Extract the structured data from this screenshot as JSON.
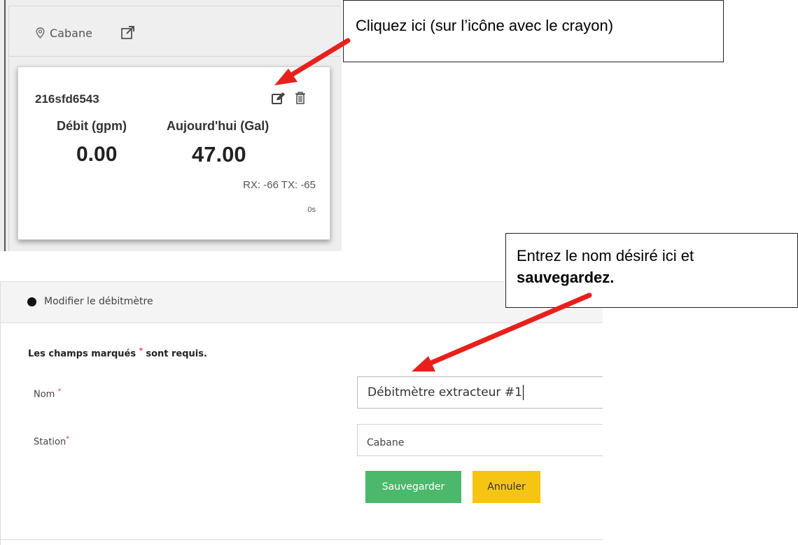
{
  "station_card": {
    "station_name": "Cabane",
    "device_id": "216sfd6543",
    "flow_label": "Débit (gpm)",
    "flow_value": "0.00",
    "today_label": "Aujourd'hui (Gal)",
    "today_value": "47.00",
    "rx_tx": "RX: -66 TX: -65",
    "age": "0s",
    "icons": {
      "station": "map-pin-icon",
      "external_link": "external-link-icon",
      "edit": "edit-pencil-icon",
      "delete": "trash-icon"
    }
  },
  "callouts": {
    "first": "Cliquez ici (sur l’icône avec le crayon)",
    "second_text": "Entrez le nom désiré ici et",
    "second_bold": "sauvegardez."
  },
  "edit_form": {
    "title": "Modifier le débitmètre",
    "required_note_prefix": "Les champs marqués",
    "required_note_suffix": "sont requis.",
    "name_label": "Nom",
    "name_value": "Débitmètre extracteur #1",
    "station_label": "Station",
    "station_value": "Cabane",
    "save_label": "Sauvegarder",
    "cancel_label": "Annuler",
    "required_marker": "*"
  },
  "colors": {
    "save_button": "#4cb86b",
    "cancel_button": "#f6c514",
    "arrow": "#e8201c",
    "required_star": "#e03a3a"
  }
}
